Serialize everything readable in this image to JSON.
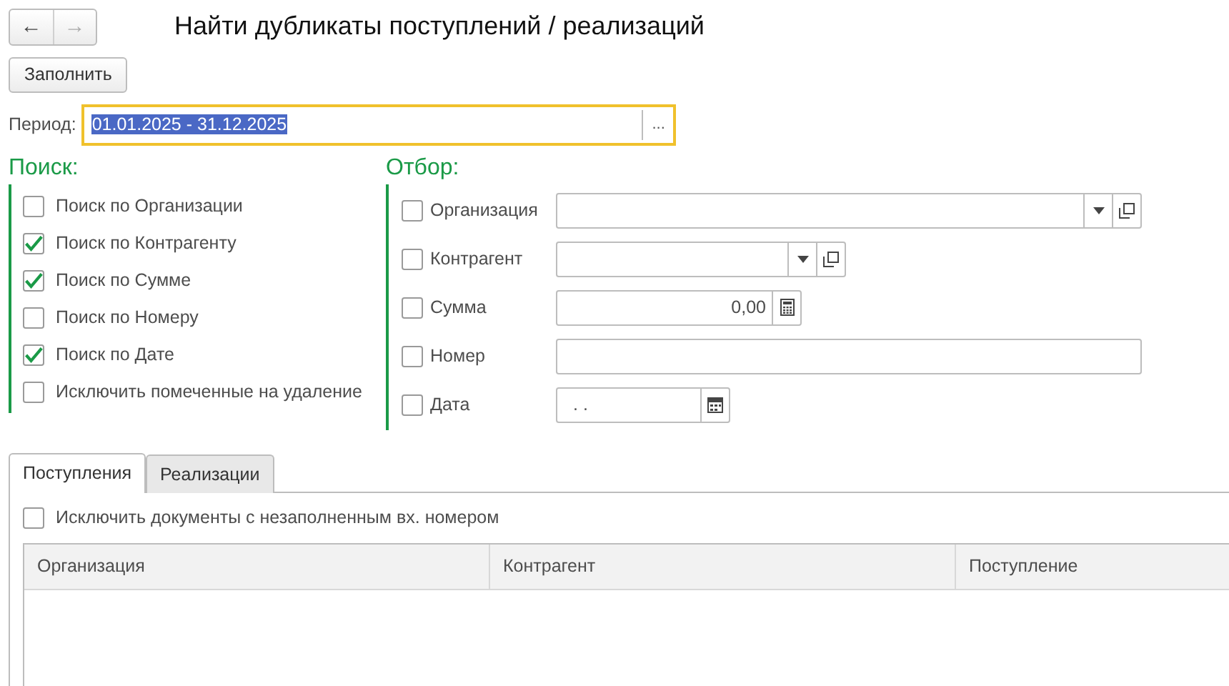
{
  "navigation": [
    {
      "symbol": "←",
      "disabled": false
    },
    {
      "symbol": "→",
      "disabled": true
    }
  ],
  "window": {
    "title": "Найти дубликаты поступлений / реализаций"
  },
  "fill_button": "Заполнить",
  "period": {
    "label": "Период:",
    "value": "01.01.2025 - 31.12.2025",
    "selected": true,
    "picker": "..."
  },
  "search": {
    "title": "Поиск:",
    "options": [
      {
        "label": "Поиск по Организации",
        "checked": false
      },
      {
        "label": "Поиск по Контрагенту",
        "checked": true
      },
      {
        "label": "Поиск по Сумме",
        "checked": true
      },
      {
        "label": "Поиск по Номеру",
        "checked": false
      },
      {
        "label": "Поиск по Дате",
        "checked": true
      },
      {
        "label": "Исключить помеченные на удаление",
        "checked": false
      }
    ]
  },
  "filter": {
    "title": "Отбор:",
    "fields": [
      {
        "label": "Организация",
        "checked": false,
        "kind": "reference"
      },
      {
        "label": "Контрагент",
        "checked": false,
        "kind": "reference"
      },
      {
        "label": "Сумма",
        "checked": false,
        "kind": "number",
        "value": "0,00"
      },
      {
        "label": "Номер",
        "checked": false,
        "kind": "text"
      },
      {
        "label": "Дата",
        "checked": false,
        "kind": "date",
        "value": ".  ."
      }
    ]
  },
  "tabs": [
    {
      "label": "Поступления",
      "selected": true
    },
    {
      "label": "Реализации",
      "selected": false
    }
  ],
  "exclude_option": {
    "label": "Исключить документы с незаполненным вх. номером",
    "checked": false
  },
  "table": {
    "columns": [
      "Организация",
      "Контрагент",
      "Поступление"
    ]
  }
}
